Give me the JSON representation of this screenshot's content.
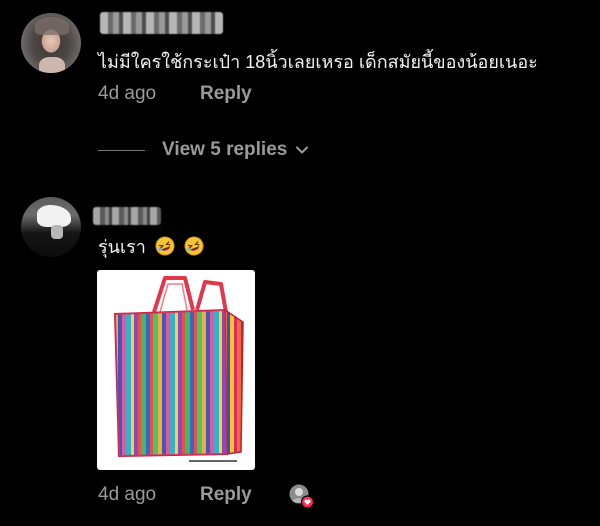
{
  "comments": [
    {
      "text": "ไม่มีใครใช้กระเป๋า 18นิ้วเลยเหรอ เด็กสมัยนี้ของน้อยเนอะ",
      "time": "4d ago",
      "reply_label": "Reply",
      "view_replies_label": "View 5 replies"
    },
    {
      "text": "รุ่นเรา",
      "emojis": [
        "rolling-on-floor-laughing",
        "rolling-on-floor-laughing"
      ],
      "time": "4d ago",
      "reply_label": "Reply",
      "liked_by_creator": true
    }
  ],
  "colors": {
    "background": "#000000",
    "text": "#f2f2f2",
    "meta": "#9a9a9a",
    "heart": "#fe2c55"
  },
  "icons": [
    "chevron-down-icon",
    "rolling-laughing-emoji-icon",
    "creator-liked-heart-icon"
  ]
}
